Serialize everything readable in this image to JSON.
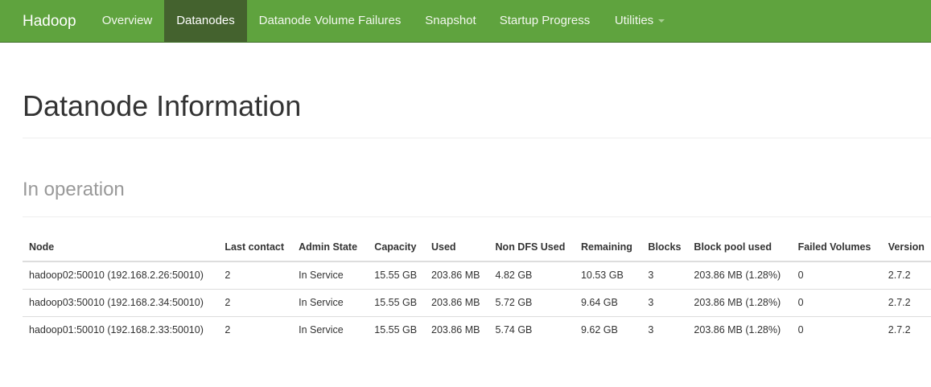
{
  "navbar": {
    "brand": "Hadoop",
    "items": [
      {
        "label": "Overview",
        "active": false
      },
      {
        "label": "Datanodes",
        "active": true
      },
      {
        "label": "Datanode Volume Failures",
        "active": false
      },
      {
        "label": "Snapshot",
        "active": false
      },
      {
        "label": "Startup Progress",
        "active": false
      },
      {
        "label": "Utilities",
        "active": false,
        "dropdown": true
      }
    ],
    "colors": {
      "background": "#5fa33e",
      "active": "#44622e"
    }
  },
  "page": {
    "title": "Datanode Information",
    "section_title": "In operation"
  },
  "table": {
    "columns": [
      "Node",
      "Last contact",
      "Admin State",
      "Capacity",
      "Used",
      "Non DFS Used",
      "Remaining",
      "Blocks",
      "Block pool used",
      "Failed Volumes",
      "Version"
    ],
    "rows": [
      [
        "hadoop02:50010 (192.168.2.26:50010)",
        "2",
        "In Service",
        "15.55 GB",
        "203.86 MB",
        "4.82 GB",
        "10.53 GB",
        "3",
        "203.86 MB (1.28%)",
        "0",
        "2.7.2"
      ],
      [
        "hadoop03:50010 (192.168.2.34:50010)",
        "2",
        "In Service",
        "15.55 GB",
        "203.86 MB",
        "5.72 GB",
        "9.64 GB",
        "3",
        "203.86 MB (1.28%)",
        "0",
        "2.7.2"
      ],
      [
        "hadoop01:50010 (192.168.2.33:50010)",
        "2",
        "In Service",
        "15.55 GB",
        "203.86 MB",
        "5.74 GB",
        "9.62 GB",
        "3",
        "203.86 MB (1.28%)",
        "0",
        "2.7.2"
      ]
    ]
  }
}
